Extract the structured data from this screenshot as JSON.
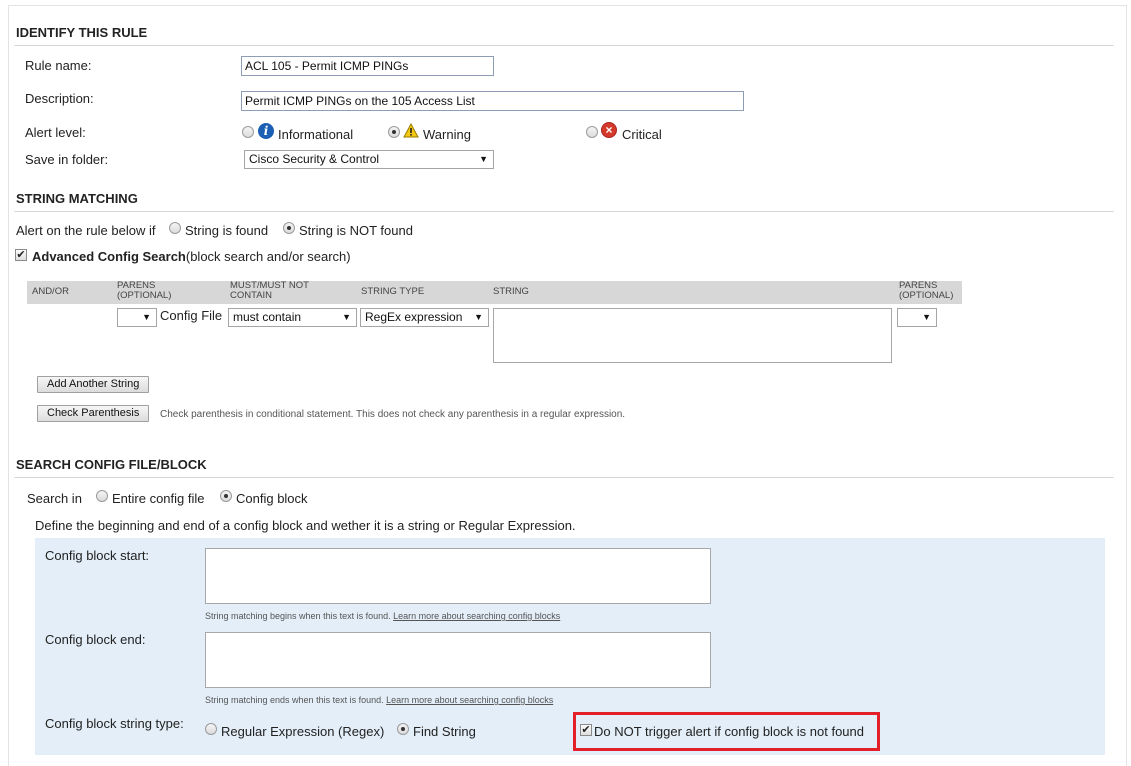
{
  "identify": {
    "title": "IDENTIFY THIS RULE",
    "rule_name_label": "Rule name:",
    "rule_name_value": "ACL 105 - Permit ICMP PINGs",
    "description_label": "Description:",
    "description_value": "Permit ICMP PINGs on the 105 Access List",
    "alert_level_label": "Alert level:",
    "alert_levels": [
      {
        "label": "Informational",
        "icon": "info-icon",
        "selected": false
      },
      {
        "label": "Warning",
        "icon": "warning-icon",
        "selected": true
      },
      {
        "label": "Critical",
        "icon": "critical-icon",
        "selected": false
      }
    ],
    "save_folder_label": "Save in folder:",
    "save_folder_value": "Cisco Security & Control"
  },
  "string_matching": {
    "title": "STRING MATCHING",
    "alert_prefix": "Alert on the rule below if",
    "option_found": "String is found",
    "option_not_found": "String is NOT found",
    "selected": "String is NOT found",
    "advanced_label": "Advanced Config Search",
    "advanced_suffix": "(block search and/or search)",
    "advanced_checked": true,
    "columns": [
      "AND/OR",
      "PARENS (OPTIONAL)",
      "MUST/MUST NOT CONTAIN",
      "STRING TYPE",
      "STRING",
      "PARENS (OPTIONAL)"
    ],
    "row": {
      "parens_open": "",
      "config_file_label": "Config File",
      "must": "must contain",
      "string_type": "RegEx expression",
      "string": "",
      "parens_close": ""
    },
    "add_button": "Add Another String",
    "check_button": "Check Parenthesis",
    "check_note": "Check parenthesis in conditional statement. This does not check any parenthesis in a regular expression."
  },
  "search_block": {
    "title": "SEARCH CONFIG FILE/BLOCK",
    "search_in_label": "Search in",
    "option_entire": "Entire config file",
    "option_block": "Config block",
    "selected": "Config block",
    "define_text": "Define the beginning and end of a config block and wether it is a string or Regular Expression.",
    "start_label": "Config block start:",
    "start_value": "",
    "start_note": "String matching begins when this text is found.",
    "start_link": "Learn more about searching config blocks",
    "end_label": "Config block end:",
    "end_value": "",
    "end_note": "String matching ends when this text is found.",
    "end_link": "Learn more about searching config blocks",
    "type_label": "Config block string type:",
    "type_regex": "Regular Expression (Regex)",
    "type_find": "Find String",
    "type_selected": "Find String",
    "not_trigger_label": "Do NOT trigger alert if config block is not found",
    "not_trigger_checked": true
  },
  "colors": {
    "highlight_border": "#e3202a",
    "panel_bg": "#e3eef8",
    "grid_header_bg": "#d7d7d7"
  }
}
